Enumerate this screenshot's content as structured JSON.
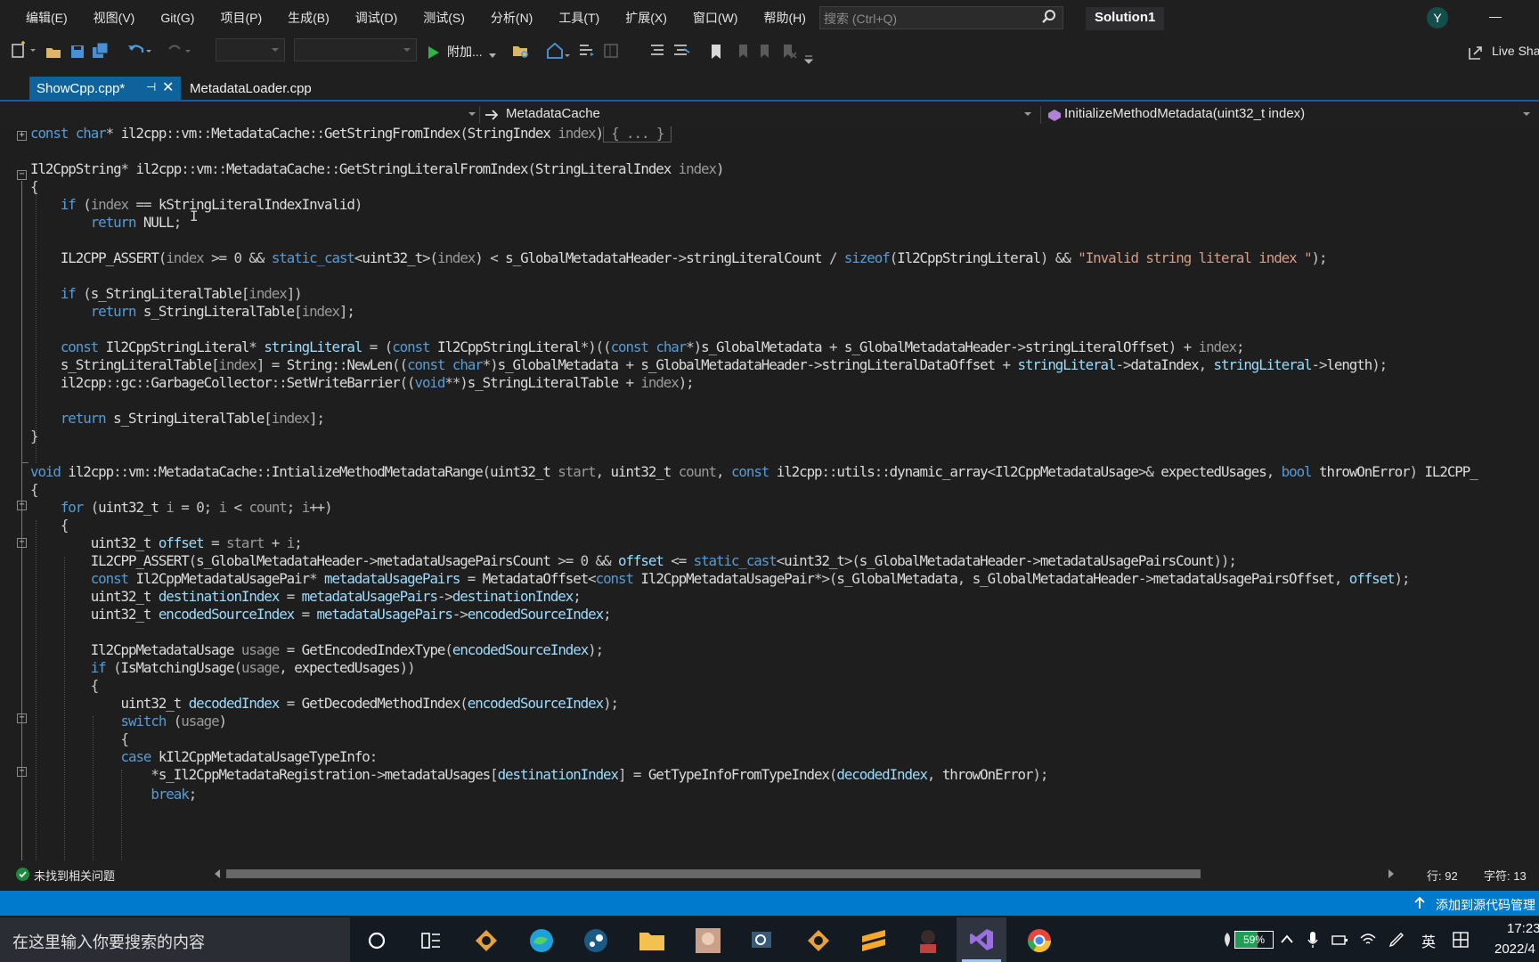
{
  "menubar": {
    "items": [
      "",
      "编辑(E)",
      "视图(V)",
      "Git(G)",
      "项目(P)",
      "生成(B)",
      "调试(D)",
      "测试(S)",
      "分析(N)",
      "工具(T)",
      "扩展(X)",
      "窗口(W)",
      "帮助(H)"
    ],
    "search_placeholder": "搜索 (Ctrl+Q)",
    "solution_title": "Solution1",
    "avatar_initial": "Y"
  },
  "toolbar": {
    "attach_label": "附加...",
    "liveshare_label": "Live Sha"
  },
  "tabs": [
    {
      "label": "ShowCpp.cpp*",
      "active": true
    },
    {
      "label": "MetadataLoader.cpp",
      "active": false
    }
  ],
  "navbar": {
    "scope": "MetadataCache",
    "member": "InitializeMethodMetadata(uint32_t index)"
  },
  "code": {
    "lines": [
      "const char* il2cpp::vm::MetadataCache::GetStringFromIndex(StringIndex index)",
      "",
      "Il2CppString* il2cpp::vm::MetadataCache::GetStringLiteralFromIndex(StringLiteralIndex index)",
      "{",
      "    if (index == kStringLiteralIndexInvalid)",
      "        return NULL;",
      "",
      "    IL2CPP_ASSERT(index >= 0 && static_cast<uint32_t>(index) < s_GlobalMetadataHeader->stringLiteralCount / sizeof(Il2CppStringLiteral) && \"Invalid string literal index \");",
      "",
      "    if (s_StringLiteralTable[index])",
      "        return s_StringLiteralTable[index];",
      "",
      "    const Il2CppStringLiteral* stringLiteral = (const Il2CppStringLiteral*)((const char*)s_GlobalMetadata + s_GlobalMetadataHeader->stringLiteralOffset) + index;",
      "    s_StringLiteralTable[index] = String::NewLen((const char*)s_GlobalMetadata + s_GlobalMetadataHeader->stringLiteralDataOffset + stringLiteral->dataIndex, stringLiteral->length);",
      "    il2cpp::gc::GarbageCollector::SetWriteBarrier((void**)s_StringLiteralTable + index);",
      "",
      "    return s_StringLiteralTable[index];",
      "}",
      "",
      "void il2cpp::vm::MetadataCache::IntializeMethodMetadataRange(uint32_t start, uint32_t count, const il2cpp::utils::dynamic_array<Il2CppMetadataUsage>& expectedUsages, bool throwOnError) IL2CPP_",
      "{",
      "    for (uint32_t i = 0; i < count; i++)",
      "    {",
      "        uint32_t offset = start + i;",
      "        IL2CPP_ASSERT(s_GlobalMetadataHeader->metadataUsagePairsCount >= 0 && offset <= static_cast<uint32_t>(s_GlobalMetadataHeader->metadataUsagePairsCount));",
      "        const Il2CppMetadataUsagePair* metadataUsagePairs = MetadataOffset<const Il2CppMetadataUsagePair*>(s_GlobalMetadata, s_GlobalMetadataHeader->metadataUsagePairsOffset, offset);",
      "        uint32_t destinationIndex = metadataUsagePairs->destinationIndex;",
      "        uint32_t encodedSourceIndex = metadataUsagePairs->encodedSourceIndex;",
      "",
      "        Il2CppMetadataUsage usage = GetEncodedIndexType(encodedSourceIndex);",
      "        if (IsMatchingUsage(usage, expectedUsages))",
      "        {",
      "            uint32_t decodedIndex = GetDecodedMethodIndex(encodedSourceIndex);",
      "            switch (usage)",
      "            {",
      "            case kIl2CppMetadataUsageTypeInfo:",
      "                *s_Il2CppMetadataRegistration->metadataUsages[destinationIndex] = GetTypeInfoFromTypeIndex(decodedIndex, throwOnError);",
      "                break;"
    ],
    "collapsed_marker": "{ ... }"
  },
  "infobar": {
    "issues_text": "未找到相关问题",
    "line_label": "行: 92",
    "char_label": "字符: 13"
  },
  "statusbar": {
    "source_control": "添加到源代码管理"
  },
  "taskbar": {
    "search_placeholder": "在这里输入你要搜索的内容",
    "battery": "59%",
    "ime": "英",
    "time": "17:23",
    "date": "2022/4"
  },
  "colors": {
    "accent": "#007acc",
    "tab_active": "#0e639c",
    "keyword": "#569cd6",
    "string": "#d69d85",
    "variable": "#9cdcfe"
  }
}
